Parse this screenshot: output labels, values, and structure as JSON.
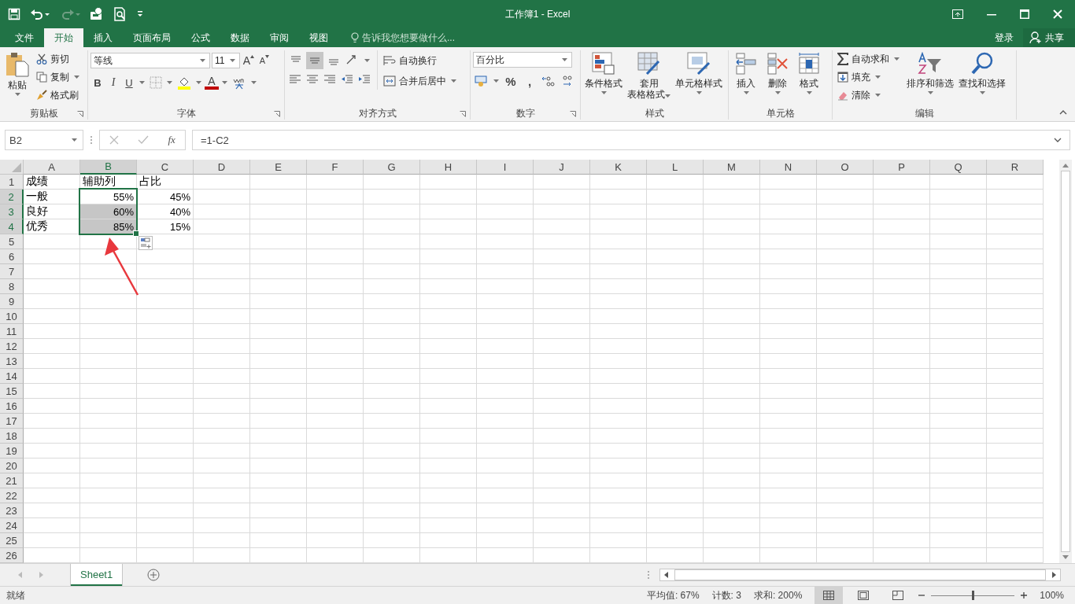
{
  "title_bar": {
    "title": "工作簿1 - Excel"
  },
  "menu_tabs": [
    {
      "label": "文件",
      "selected": false
    },
    {
      "label": "开始",
      "selected": true
    },
    {
      "label": "插入",
      "selected": false
    },
    {
      "label": "页面布局",
      "selected": false
    },
    {
      "label": "公式",
      "selected": false
    },
    {
      "label": "数据",
      "selected": false
    },
    {
      "label": "审阅",
      "selected": false
    },
    {
      "label": "视图",
      "selected": false
    }
  ],
  "tell_me": {
    "placeholder": "告诉我您想要做什么..."
  },
  "account": {
    "sign_in": "登录",
    "share": "共享"
  },
  "ribbon": {
    "clipboard": {
      "paste": "粘贴",
      "cut": "剪切",
      "copy": "复制",
      "format_painter": "格式刷",
      "label": "剪贴板"
    },
    "font": {
      "font_name": "等线",
      "font_size": "11",
      "grow": "A",
      "shrink": "A",
      "bold": "B",
      "italic": "I",
      "underline": "U",
      "font_color": "A",
      "label": "字体"
    },
    "alignment": {
      "vertical_align": [
        {
          "selected": false
        },
        {
          "selected": true
        },
        {
          "selected": false
        }
      ],
      "wrap_text": "自动换行",
      "merge_center": "合并后居中",
      "label": "对齐方式"
    },
    "number": {
      "format": "百分比",
      "percent": "%",
      "comma": ",",
      "label": "数字"
    },
    "styles": {
      "conditional": "条件格式",
      "table_format": [
        "套用",
        "表格格式"
      ],
      "cell_styles": "单元格样式",
      "label": "样式"
    },
    "cells": {
      "insert": "插入",
      "delete": "删除",
      "format": "格式",
      "label": "单元格"
    },
    "editing": {
      "autosum": "自动求和",
      "fill": "填充",
      "clear": "清除",
      "sort_filter": "排序和筛选",
      "find_select": "查找和选择",
      "label": "编辑"
    }
  },
  "formula_bar": {
    "name_box": "B2",
    "function_key": "fx",
    "formula": "=1-C2"
  },
  "columns": [
    {
      "label": "A",
      "selected": false
    },
    {
      "label": "B",
      "selected": true
    },
    {
      "label": "C",
      "selected": false
    },
    {
      "label": "D",
      "selected": false
    },
    {
      "label": "E",
      "selected": false
    },
    {
      "label": "F",
      "selected": false
    },
    {
      "label": "G",
      "selected": false
    },
    {
      "label": "H",
      "selected": false
    },
    {
      "label": "I",
      "selected": false
    },
    {
      "label": "J",
      "selected": false
    },
    {
      "label": "K",
      "selected": false
    },
    {
      "label": "L",
      "selected": false
    },
    {
      "label": "M",
      "selected": false
    },
    {
      "label": "N",
      "selected": false
    },
    {
      "label": "O",
      "selected": false
    },
    {
      "label": "P",
      "selected": false
    },
    {
      "label": "Q",
      "selected": false
    },
    {
      "label": "R",
      "selected": false
    }
  ],
  "rows": [
    {
      "header": "1",
      "selected": false,
      "cells": [
        {
          "text": "成绩",
          "kind": "text",
          "selected": false
        },
        {
          "text": "辅助列",
          "kind": "text",
          "selected": false
        },
        {
          "text": "占比",
          "kind": "text",
          "selected": false
        }
      ]
    },
    {
      "header": "2",
      "selected": true,
      "cells": [
        {
          "text": "一般",
          "kind": "text",
          "selected": false
        },
        {
          "text": "55%",
          "kind": "number",
          "selected": true,
          "active": true
        },
        {
          "text": "45%",
          "kind": "number",
          "selected": false
        }
      ]
    },
    {
      "header": "3",
      "selected": true,
      "cells": [
        {
          "text": "良好",
          "kind": "text",
          "selected": false
        },
        {
          "text": "60%",
          "kind": "number",
          "selected": true,
          "active": false
        },
        {
          "text": "40%",
          "kind": "number",
          "selected": false
        }
      ]
    },
    {
      "header": "4",
      "selected": true,
      "cells": [
        {
          "text": "优秀",
          "kind": "text",
          "selected": false
        },
        {
          "text": "85%",
          "kind": "number",
          "selected": true,
          "active": false
        },
        {
          "text": "15%",
          "kind": "number",
          "selected": false
        }
      ]
    },
    {
      "header": "5",
      "selected": false,
      "cells": []
    },
    {
      "header": "6",
      "selected": false,
      "cells": []
    },
    {
      "header": "7",
      "selected": false,
      "cells": []
    },
    {
      "header": "8",
      "selected": false,
      "cells": []
    },
    {
      "header": "9",
      "selected": false,
      "cells": []
    },
    {
      "header": "10",
      "selected": false,
      "cells": []
    },
    {
      "header": "11",
      "selected": false,
      "cells": []
    },
    {
      "header": "12",
      "selected": false,
      "cells": []
    },
    {
      "header": "13",
      "selected": false,
      "cells": []
    },
    {
      "header": "14",
      "selected": false,
      "cells": []
    },
    {
      "header": "15",
      "selected": false,
      "cells": []
    },
    {
      "header": "16",
      "selected": false,
      "cells": []
    },
    {
      "header": "17",
      "selected": false,
      "cells": []
    },
    {
      "header": "18",
      "selected": false,
      "cells": []
    },
    {
      "header": "19",
      "selected": false,
      "cells": []
    },
    {
      "header": "20",
      "selected": false,
      "cells": []
    },
    {
      "header": "21",
      "selected": false,
      "cells": []
    },
    {
      "header": "22",
      "selected": false,
      "cells": []
    },
    {
      "header": "23",
      "selected": false,
      "cells": []
    },
    {
      "header": "24",
      "selected": false,
      "cells": []
    },
    {
      "header": "25",
      "selected": false,
      "cells": []
    },
    {
      "header": "26",
      "selected": false,
      "cells": []
    }
  ],
  "sheet_tabs": [
    {
      "label": "Sheet1",
      "selected": true
    }
  ],
  "status_bar": {
    "ready": "就绪",
    "average": "平均值: 67%",
    "count": "计数: 3",
    "sum": "求和: 200%",
    "views": [
      {
        "selected": true
      },
      {
        "selected": false
      },
      {
        "selected": false
      }
    ],
    "zoom": {
      "level": 0.5,
      "reading": "100%"
    }
  }
}
